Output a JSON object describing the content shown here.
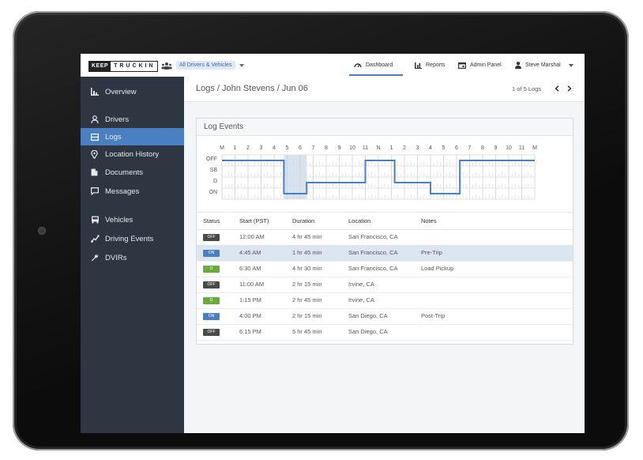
{
  "topbar": {
    "logo_keep": "KEEP",
    "logo_truckin": "TRUCKIN",
    "fleet_selector": "All Drivers & Vehicles",
    "nav": {
      "dashboard": "Dashboard",
      "reports": "Reports",
      "admin_panel": "Admin Panel",
      "user_name": "Steve Marshal"
    }
  },
  "sidebar": {
    "items": [
      {
        "label": "Overview",
        "icon": "overview-icon"
      },
      {
        "label": "Drivers",
        "icon": "driver-icon"
      },
      {
        "label": "Logs",
        "icon": "logs-icon",
        "active": true
      },
      {
        "label": "Location History",
        "icon": "location-pin-icon"
      },
      {
        "label": "Documents",
        "icon": "document-icon"
      },
      {
        "label": "Messages",
        "icon": "message-icon"
      },
      {
        "label": "Vehicles",
        "icon": "vehicle-icon"
      },
      {
        "label": "Driving Events",
        "icon": "driving-events-icon"
      },
      {
        "label": "DVIRs",
        "icon": "wrench-icon"
      }
    ]
  },
  "breadcrumb": "Logs / John Stevens / Jun 06",
  "pager": {
    "text": "1 of 5 Logs"
  },
  "log_events": {
    "title": "Log Events",
    "hour_labels": [
      "M",
      "1",
      "2",
      "3",
      "4",
      "5",
      "6",
      "7",
      "8",
      "9",
      "10",
      "11",
      "N",
      "1",
      "2",
      "3",
      "4",
      "5",
      "6",
      "7",
      "8",
      "9",
      "10",
      "11",
      "M"
    ],
    "status_rows": [
      "OFF",
      "SB",
      "D",
      "ON"
    ],
    "highlight_hours": [
      4.75,
      6.5
    ],
    "line_color": "#4a7fc1",
    "segments": [
      {
        "status": "OFF",
        "start": 0,
        "end": 4.75
      },
      {
        "status": "ON",
        "start": 4.75,
        "end": 6.5
      },
      {
        "status": "D",
        "start": 6.5,
        "end": 11.0
      },
      {
        "status": "OFF",
        "start": 11.0,
        "end": 13.25
      },
      {
        "status": "D",
        "start": 13.25,
        "end": 16.0
      },
      {
        "status": "ON",
        "start": 16.0,
        "end": 18.25
      },
      {
        "status": "OFF",
        "start": 18.25,
        "end": 24
      }
    ]
  },
  "table": {
    "headers": [
      "Status",
      "Start (PST)",
      "Duration",
      "Location",
      "Notes"
    ],
    "rows": [
      {
        "status": "OFF",
        "start": "12:00 AM",
        "duration": "4 hr 45 min",
        "location": "San Francisco, CA",
        "notes": "",
        "selected": false
      },
      {
        "status": "ON",
        "start": "4:45 AM",
        "duration": "1 hr 45 min",
        "location": "San Francisco, CA",
        "notes": "Pre-Trip",
        "selected": true
      },
      {
        "status": "D",
        "start": "6:30 AM",
        "duration": "4 hr 30 min",
        "location": "San Francisco, CA",
        "notes": "Load Pickup",
        "selected": false
      },
      {
        "status": "OFF",
        "start": "11:00 AM",
        "duration": "2 hr 15 min",
        "location": "Irvine, CA",
        "notes": "",
        "selected": false
      },
      {
        "status": "D",
        "start": "1:15 PM",
        "duration": "2 hr 45 min",
        "location": "Irvine, CA",
        "notes": "",
        "selected": false
      },
      {
        "status": "ON",
        "start": "4:00 PM",
        "duration": "2 hr 15 min",
        "location": "San Diego, CA",
        "notes": "Post-Trip",
        "selected": false
      },
      {
        "status": "OFF",
        "start": "6:15 PM",
        "duration": "5 hr 45 min",
        "location": "San Diego, CA",
        "notes": "",
        "selected": false
      }
    ]
  },
  "colors": {
    "accent": "#4a7fc1",
    "sidebar": "#2e3741",
    "status_off": "#4a4a4a",
    "status_on": "#4a7fc1",
    "status_d": "#6aac3c"
  }
}
